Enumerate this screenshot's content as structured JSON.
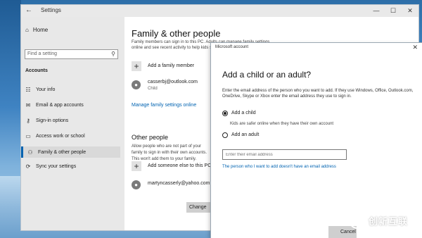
{
  "window": {
    "title": "Settings",
    "back_glyph": "←",
    "controls": [
      "—",
      "☐",
      "✕"
    ]
  },
  "sidebar": {
    "home": "Home",
    "search_placeholder": "Find a setting",
    "section": "Accounts",
    "items": [
      {
        "label": "Your info",
        "icon": "person-card-icon"
      },
      {
        "label": "Email & app accounts",
        "icon": "envelope-icon"
      },
      {
        "label": "Sign-in options",
        "icon": "key-icon"
      },
      {
        "label": "Access work or school",
        "icon": "briefcase-icon"
      },
      {
        "label": "Family & other people",
        "icon": "people-icon",
        "active": true
      },
      {
        "label": "Sync your settings",
        "icon": "sync-icon"
      }
    ]
  },
  "main": {
    "title": "Family & other people",
    "description": "Family members can sign in to this PC. Adults can manage family settings online and see recent activity to help kids stay safe.",
    "add_family": "Add a family member",
    "family_member_email": "casserbj@outlook.com",
    "family_member_role": "Child",
    "manage_link": "Manage family settings online",
    "other_people_title": "Other people",
    "other_people_desc": "Allow people who are not part of your family to sign in with their own accounts. This won't add them to your family.",
    "add_someone": "Add someone else to this PC",
    "other_user_email": "martyncasserly@yahoo.com",
    "change_button": "Change account type"
  },
  "dialog": {
    "title": "Microsoft account",
    "close_glyph": "✕",
    "heading": "Add a child or an adult?",
    "body": "Enter the email address of the person who you want to add. If they use Windows, Office, Outlook.com, OneDrive, Skype or Xbox enter the email address they use to sign in.",
    "option_child": "Add a child",
    "option_child_note": "Kids are safer online when they have their own account",
    "option_adult": "Add an adult",
    "selected": "child",
    "email_placeholder": "Enter their email address",
    "no_email_link": "The person who I want to add doesn't have an email address",
    "button": "Cancel"
  },
  "watermark": {
    "text": "创新互联"
  },
  "colors": {
    "accent": "#0063b1",
    "sidebar_bg": "#e8e8e8",
    "titlebar_bg": "#e9e9e9"
  }
}
